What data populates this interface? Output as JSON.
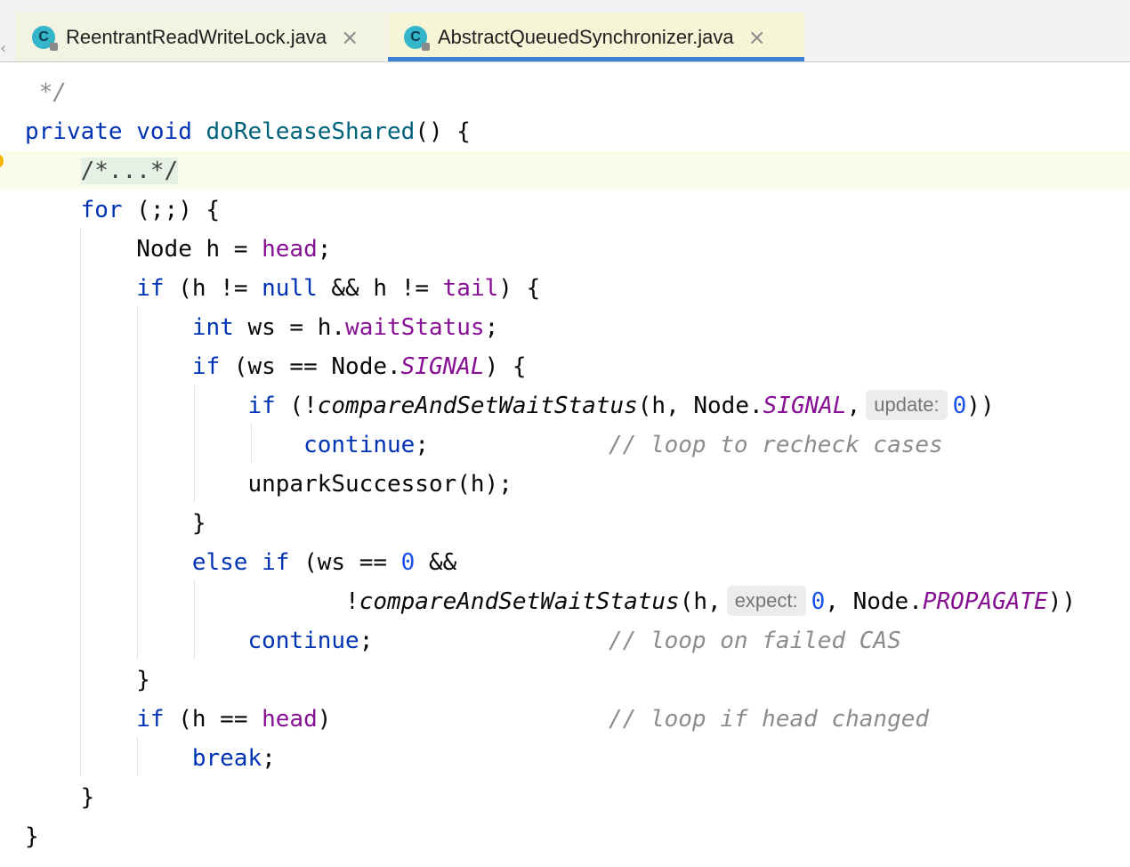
{
  "tabs": [
    {
      "icon": "C",
      "label": "ReentrantReadWriteLock.java",
      "active": false
    },
    {
      "icon": "C",
      "label": "AbstractQueuedSynchronizer.java",
      "active": true
    }
  ],
  "code": {
    "l0_doc_end": " */",
    "l1_private": "private",
    "l1_void": "void",
    "l1_method": "doReleaseShared",
    "l1_rest": "() {",
    "l2_fold": "/*...*/",
    "l3_for": "for",
    "l3_rest": " (;;) {",
    "l4_a": "Node h = ",
    "l4_head": "head",
    "l4_b": ";",
    "l5_if": "if",
    "l5_a": " (h != ",
    "l5_null": "null",
    "l5_b": " && h != ",
    "l5_tail": "tail",
    "l5_c": ") {",
    "l6_int": "int",
    "l6_a": " ws = h.",
    "l6_field": "waitStatus",
    "l6_b": ";",
    "l7_if": "if",
    "l7_a": " (ws == Node.",
    "l7_signal": "SIGNAL",
    "l7_b": ") {",
    "l8_if": "if",
    "l8_a": " (!",
    "l8_call": "compareAndSetWaitStatus",
    "l8_b": "(h, Node.",
    "l8_signal": "SIGNAL",
    "l8_c": ",",
    "l8_hint": "update:",
    "l8_zero": "0",
    "l8_d": "))",
    "l9_continue": "continue",
    "l9_a": ";",
    "l9_comment": "// loop to recheck cases",
    "l10_stmt": "unparkSuccessor(h);",
    "l11_brace": "}",
    "l12_else": "else",
    "l12_if": "if",
    "l12_a": " (ws == ",
    "l12_zero": "0",
    "l12_b": " &&",
    "l13_a": "!",
    "l13_call": "compareAndSetWaitStatus",
    "l13_b": "(h,",
    "l13_hint": "expect:",
    "l13_zero": "0",
    "l13_c": ", Node.",
    "l13_prop": "PROPAGATE",
    "l13_d": "))",
    "l14_continue": "continue",
    "l14_a": ";",
    "l14_comment": "// loop on failed CAS",
    "l15_brace": "}",
    "l16_if": "if",
    "l16_a": " (h == ",
    "l16_head": "head",
    "l16_b": ")",
    "l16_comment": "// loop if head changed",
    "l17_break": "break",
    "l17_a": ";",
    "l18_brace": "}",
    "l19_brace": "}"
  }
}
